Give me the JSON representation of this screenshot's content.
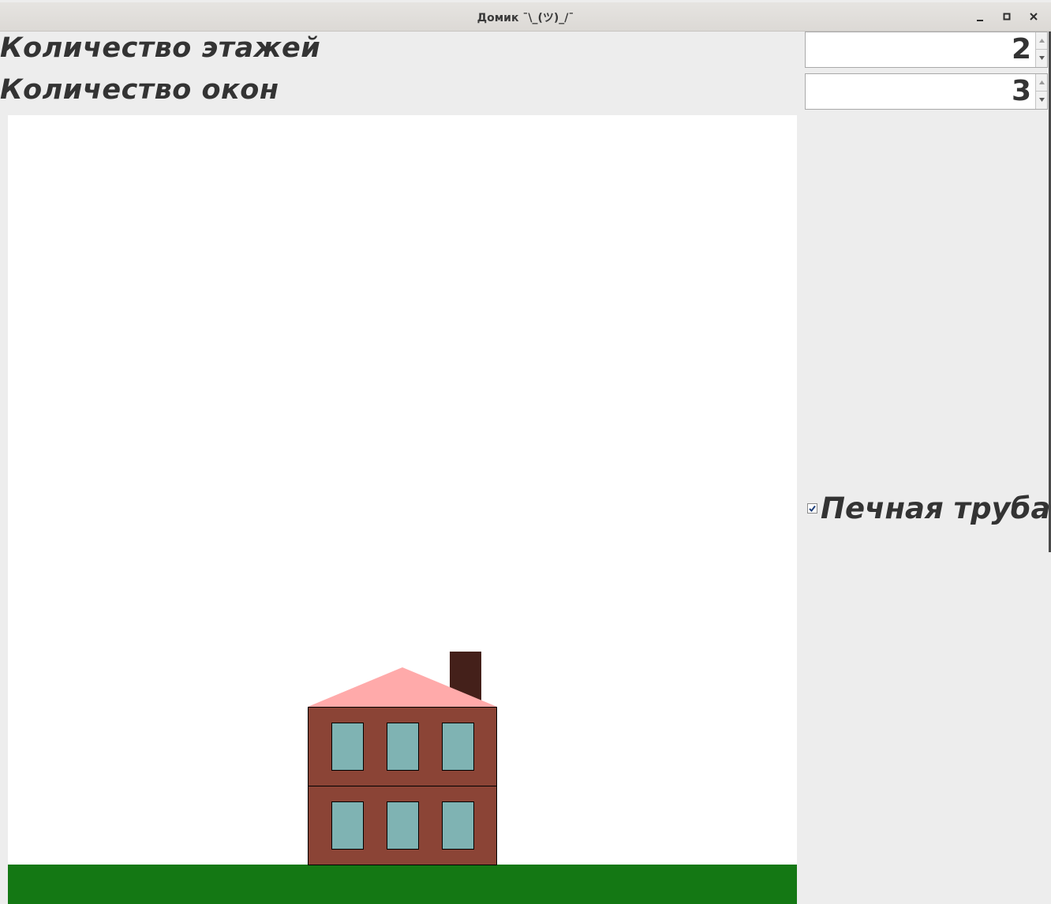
{
  "window": {
    "title": "Домик ¯\\_(ツ)_/¯"
  },
  "controls": {
    "floors_label": "Количество этажей",
    "floors_value": "2",
    "windows_label": "Количество окон",
    "windows_value": "3",
    "chimney_label": "Печная труба",
    "chimney_checked": true
  },
  "house": {
    "floors": 2,
    "windows_per_floor": 3,
    "has_chimney": true,
    "colors": {
      "wall": "#8B4436",
      "roof": "#FFAAAA",
      "window": "#7FB3B3",
      "chimney": "#44201A",
      "grass": "#147814",
      "sky": "#FFFFFF"
    }
  }
}
